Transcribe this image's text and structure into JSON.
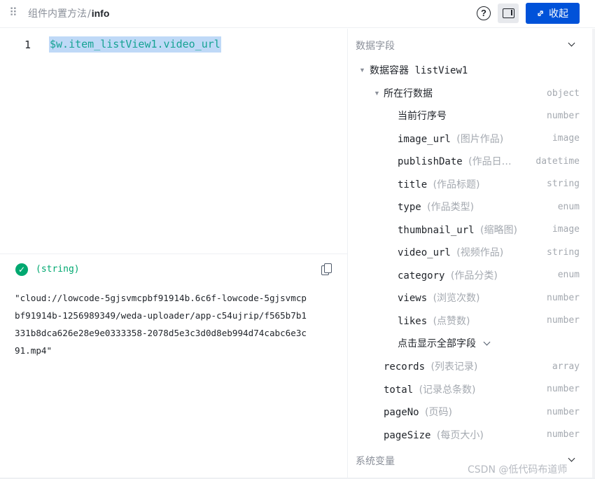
{
  "header": {
    "breadcrumb_parent": "组件内置方法",
    "breadcrumb_sep": "/",
    "breadcrumb_current": "info",
    "help_label": "?",
    "collapse_label": "收起"
  },
  "editor": {
    "line_number": "1",
    "code": "$w.item_listView1.video_url"
  },
  "result": {
    "type_label": "(string)",
    "value": "\"cloud://lowcode-5gjsvmcpbf91914b.6c6f-lowcode-5gjsvmcpbf91914b-1256989349/weda-uploader/app-c54ujrip/f565b7b1331b8dca626e28e9e0333358-2078d5e3c3d0d8eb994d74cabc6e3c91.mp4\""
  },
  "fields_panel": {
    "title": "数据字段",
    "container": {
      "label": "数据容器",
      "name": "listView1"
    },
    "row_data": {
      "label": "所在行数据",
      "type": "object"
    },
    "items": [
      {
        "name": "当前行序号",
        "alias": "",
        "type": "number"
      },
      {
        "name": "image_url",
        "alias": "(图片作品)",
        "type": "image"
      },
      {
        "name": "publishDate",
        "alias": "(作品日…",
        "type": "datetime"
      },
      {
        "name": "title",
        "alias": "(作品标题)",
        "type": "string"
      },
      {
        "name": "type",
        "alias": "(作品类型)",
        "type": "enum"
      },
      {
        "name": "thumbnail_url",
        "alias": "(缩略图)",
        "type": "image"
      },
      {
        "name": "video_url",
        "alias": "(视频作品)",
        "type": "string"
      },
      {
        "name": "category",
        "alias": "(作品分类)",
        "type": "enum"
      },
      {
        "name": "views",
        "alias": "(浏览次数)",
        "type": "number"
      },
      {
        "name": "likes",
        "alias": "(点赞数)",
        "type": "number"
      }
    ],
    "show_all_label": "点击显示全部字段",
    "list_fields": [
      {
        "name": "records",
        "alias": "(列表记录)",
        "type": "array"
      },
      {
        "name": "total",
        "alias": "(记录总条数)",
        "type": "number"
      },
      {
        "name": "pageNo",
        "alias": "(页码)",
        "type": "number"
      },
      {
        "name": "pageSize",
        "alias": "(每页大小)",
        "type": "number"
      }
    ],
    "system_vars_title": "系统变量"
  },
  "watermark": "CSDN @低代码布道师"
}
